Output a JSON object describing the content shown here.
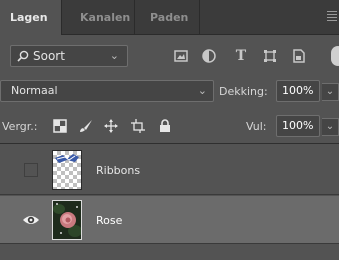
{
  "tabs": [
    {
      "label": "Lagen",
      "active": true
    },
    {
      "label": "Kanalen",
      "active": false
    },
    {
      "label": "Paden",
      "active": false
    }
  ],
  "filter": {
    "label": "Soort",
    "icons": [
      "image-filter-icon",
      "adjustment-filter-icon",
      "type-filter-icon",
      "shape-filter-icon",
      "smart-object-filter-icon"
    ]
  },
  "blend": {
    "mode": "Normaal",
    "opacity_label": "Dekking:",
    "opacity_value": "100%"
  },
  "lock": {
    "label": "Vergr.:",
    "icons": [
      "lock-transparent-pixels-icon",
      "lock-image-pixels-icon",
      "lock-position-icon",
      "lock-artboard-icon",
      "lock-all-icon"
    ],
    "fill_label": "Vul:",
    "fill_value": "100%"
  },
  "layers": [
    {
      "name": "Ribbons",
      "visible": false,
      "selected": false
    },
    {
      "name": "Rose",
      "visible": true,
      "selected": true
    }
  ],
  "colors": {
    "panel_bg": "#535353",
    "tabbar_bg": "#3b3b3b",
    "selected_layer_bg": "#6b6b6b"
  }
}
